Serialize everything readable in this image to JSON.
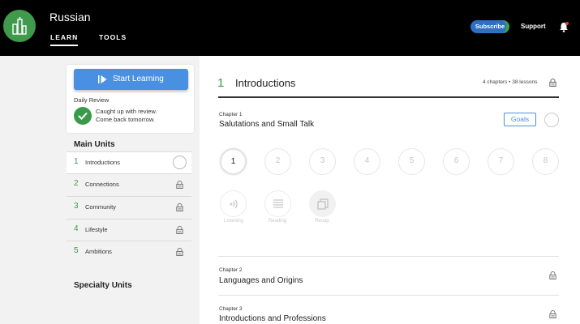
{
  "app": {
    "title": "Russian"
  },
  "nav": {
    "learn": "LEARN",
    "tools": "TOOLS"
  },
  "header_actions": {
    "subscribe": "Subscribe",
    "support": "Support",
    "bell_icon": "bell-icon"
  },
  "sidebar": {
    "start_button": "Start Learning",
    "daily_review": {
      "heading": "Daily Review",
      "line1": "Caught up with review.",
      "line2": "Come back tomorrow."
    },
    "main_units_heading": "Main Units",
    "units": [
      {
        "num": "1",
        "label": "Introductions",
        "status": "open"
      },
      {
        "num": "2",
        "label": "Connections",
        "status": "locked"
      },
      {
        "num": "3",
        "label": "Community",
        "status": "locked"
      },
      {
        "num": "4",
        "label": "Lifestyle",
        "status": "locked"
      },
      {
        "num": "5",
        "label": "Ambitions",
        "status": "locked"
      }
    ],
    "specialty_units_heading": "Specialty Units"
  },
  "unit": {
    "num": "1",
    "title": "Introductions",
    "meta": "4 chapters • 38 lessons",
    "chapters": [
      {
        "kicker": "Chapter 1",
        "title": "Salutations and Small Talk",
        "goals_label": "Goals",
        "lessons": [
          "1",
          "2",
          "3",
          "4",
          "5",
          "6",
          "7",
          "8"
        ],
        "activities": [
          "Listening",
          "Reading",
          "Recap"
        ]
      },
      {
        "kicker": "Chapter 2",
        "title": "Languages and Origins"
      },
      {
        "kicker": "Chapter 3",
        "title": "Introductions and Professions"
      }
    ]
  },
  "colors": {
    "accent_green": "#3a9a4a",
    "accent_blue": "#4a90e2",
    "topbar": "#000000"
  }
}
